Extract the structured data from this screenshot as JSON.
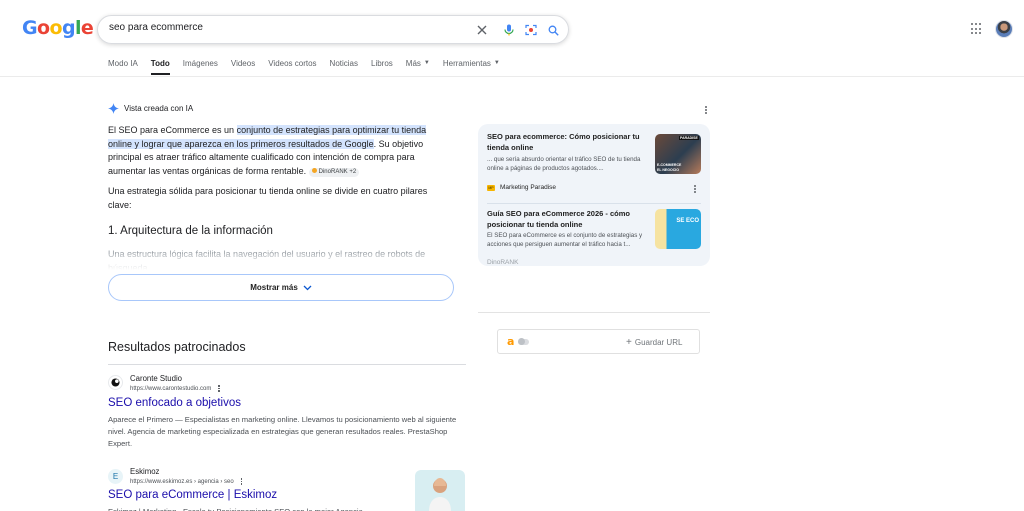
{
  "logo": {
    "letters": [
      "G",
      "o",
      "o",
      "g",
      "l",
      "e"
    ]
  },
  "search": {
    "query": "seo para ecommerce"
  },
  "tabs": [
    {
      "label": "Modo IA"
    },
    {
      "label": "Todo"
    },
    {
      "label": "Imágenes"
    },
    {
      "label": "Videos"
    },
    {
      "label": "Videos cortos"
    },
    {
      "label": "Noticias"
    },
    {
      "label": "Libros"
    },
    {
      "label": "Más"
    },
    {
      "label": "Herramientas"
    }
  ],
  "ai": {
    "heading": "Vista creada con IA",
    "p1_before": "El SEO para eCommerce es un ",
    "p1_highlight": "conjunto de estrategias para optimizar tu tienda online y lograr que aparezca en los primeros resultados de Google",
    "p1_after": ". Su objetivo principal es atraer tráfico altamente cualificado con intención de compra para aumentar las ventas orgánicas de forma rentable.",
    "chip": "DinoRANK +2",
    "p2": "Una estrategia sólida para posicionar tu tienda online se divide en cuatro pilares clave:",
    "h2": "1. Arquitectura de la información",
    "fade": "Una estructura lógica facilita la navegación del usuario y el rastreo de robots de búsqueda.",
    "more": "Mostrar más"
  },
  "sources": [
    {
      "title": "SEO para ecommerce: Cómo posicionar tu tienda online",
      "snippet": "... que sería absurdo orientar el tráfico SEO de tu tienda online a páginas de productos agotados....",
      "name": "Marketing Paradise",
      "fav_label": "MP",
      "thumb_caption": "E-COMMERCE EL NEGOCIO",
      "thumb_tag": "PARADISE"
    },
    {
      "title": "Guía SEO para eCommerce 2026 - cómo posicionar tu tienda online",
      "snippet": "El SEO para eCommerce es el conjunto de estrategias y acciones que persiguen aumentar el tráfico hacia t...",
      "name": "DinoRANK",
      "thumb_caption": "SE ECO"
    }
  ],
  "save_url": {
    "amazon": "a",
    "label": "Guardar URL"
  },
  "sponsored": {
    "title": "Resultados patrocinados",
    "ads": [
      {
        "site": "Caronte Studio",
        "url": "https://www.carontestudio.com",
        "link": "SEO enfocado a objetivos",
        "desc": "Aparece el Primero — Especialistas en marketing online. Llevamos tu posicionamiento web al siguiente nivel. Agencia de marketing especializada en estrategias que generan resultados reales. PrestaShop Expert."
      },
      {
        "site": "Eskimoz",
        "fav": "E",
        "url": "https://www.eskimoz.es › agencia › seo",
        "link": "SEO para eCommerce | Eskimoz",
        "desc": "Eskimoz | Marketing · Escala tu Posicionamiento SEO con la mejor Agencia."
      }
    ]
  },
  "colors": {
    "link": "#1a0dab",
    "highlight": "#d3e3fd",
    "accent_blue": "#4285f4"
  }
}
